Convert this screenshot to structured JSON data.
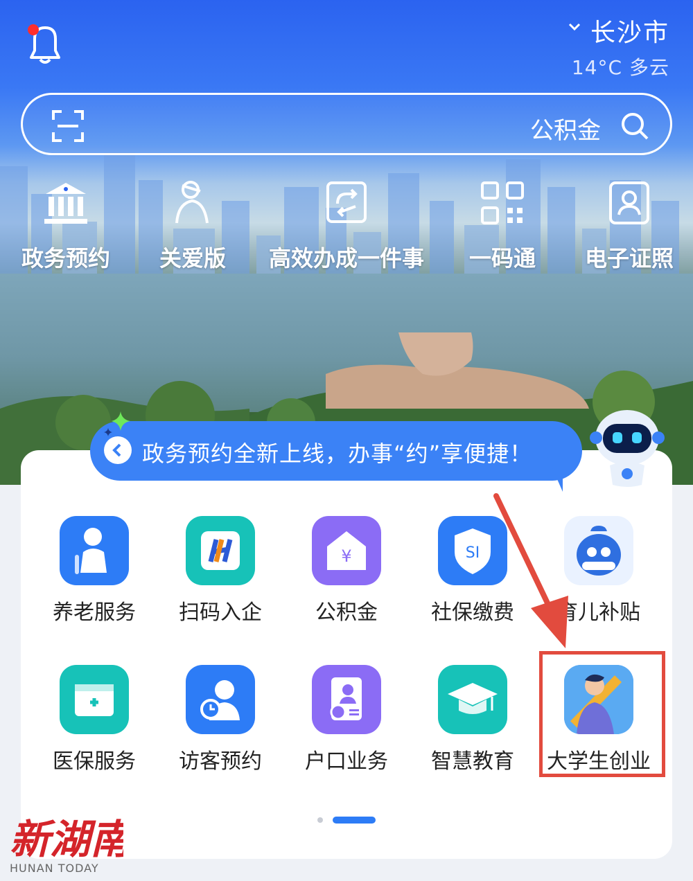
{
  "header": {
    "city": "长沙市",
    "weather": "14°C 多云"
  },
  "search": {
    "text": "公积金"
  },
  "quick_links": [
    {
      "label": "政务预约",
      "icon": "government-building-icon"
    },
    {
      "label": "关爱版",
      "icon": "care-person-icon"
    },
    {
      "label": "高效办成一件事",
      "icon": "process-refresh-icon"
    },
    {
      "label": "一码通",
      "icon": "qr-code-icon"
    },
    {
      "label": "电子证照",
      "icon": "id-card-icon"
    }
  ],
  "banner": {
    "text": "政务预约全新上线，办事“约”享便捷！"
  },
  "services_row1": [
    {
      "label": "养老服务",
      "icon": "elderly-care-icon",
      "color": "#2d7cf6"
    },
    {
      "label": "扫码入企",
      "icon": "scan-enterprise-icon",
      "color": "#17c2b8"
    },
    {
      "label": "公积金",
      "icon": "house-fund-icon",
      "color": "#8b6cf5"
    },
    {
      "label": "社保缴费",
      "icon": "social-security-shield-icon",
      "color": "#2d7cf6"
    },
    {
      "label": "育儿补贴",
      "icon": "childcare-subsidy-icon",
      "color": "#2f6fe0"
    }
  ],
  "services_row2": [
    {
      "label": "医保服务",
      "icon": "medical-insurance-icon",
      "color": "#17c2b8"
    },
    {
      "label": "访客预约",
      "icon": "visitor-appointment-icon",
      "color": "#2d7cf6"
    },
    {
      "label": "户口业务",
      "icon": "household-register-icon",
      "color": "#8b6cf5"
    },
    {
      "label": "智慧教育",
      "icon": "graduation-cap-icon",
      "color": "#17c2b8"
    },
    {
      "label": "大学生创业",
      "icon": "student-entrepreneur-icon",
      "color": "#3a8ef0"
    }
  ],
  "watermark": {
    "logo": "新湖南",
    "sub": "HUNAN TODAY"
  },
  "colors": {
    "primary": "#2b63f0",
    "highlight": "#e24b3e"
  }
}
